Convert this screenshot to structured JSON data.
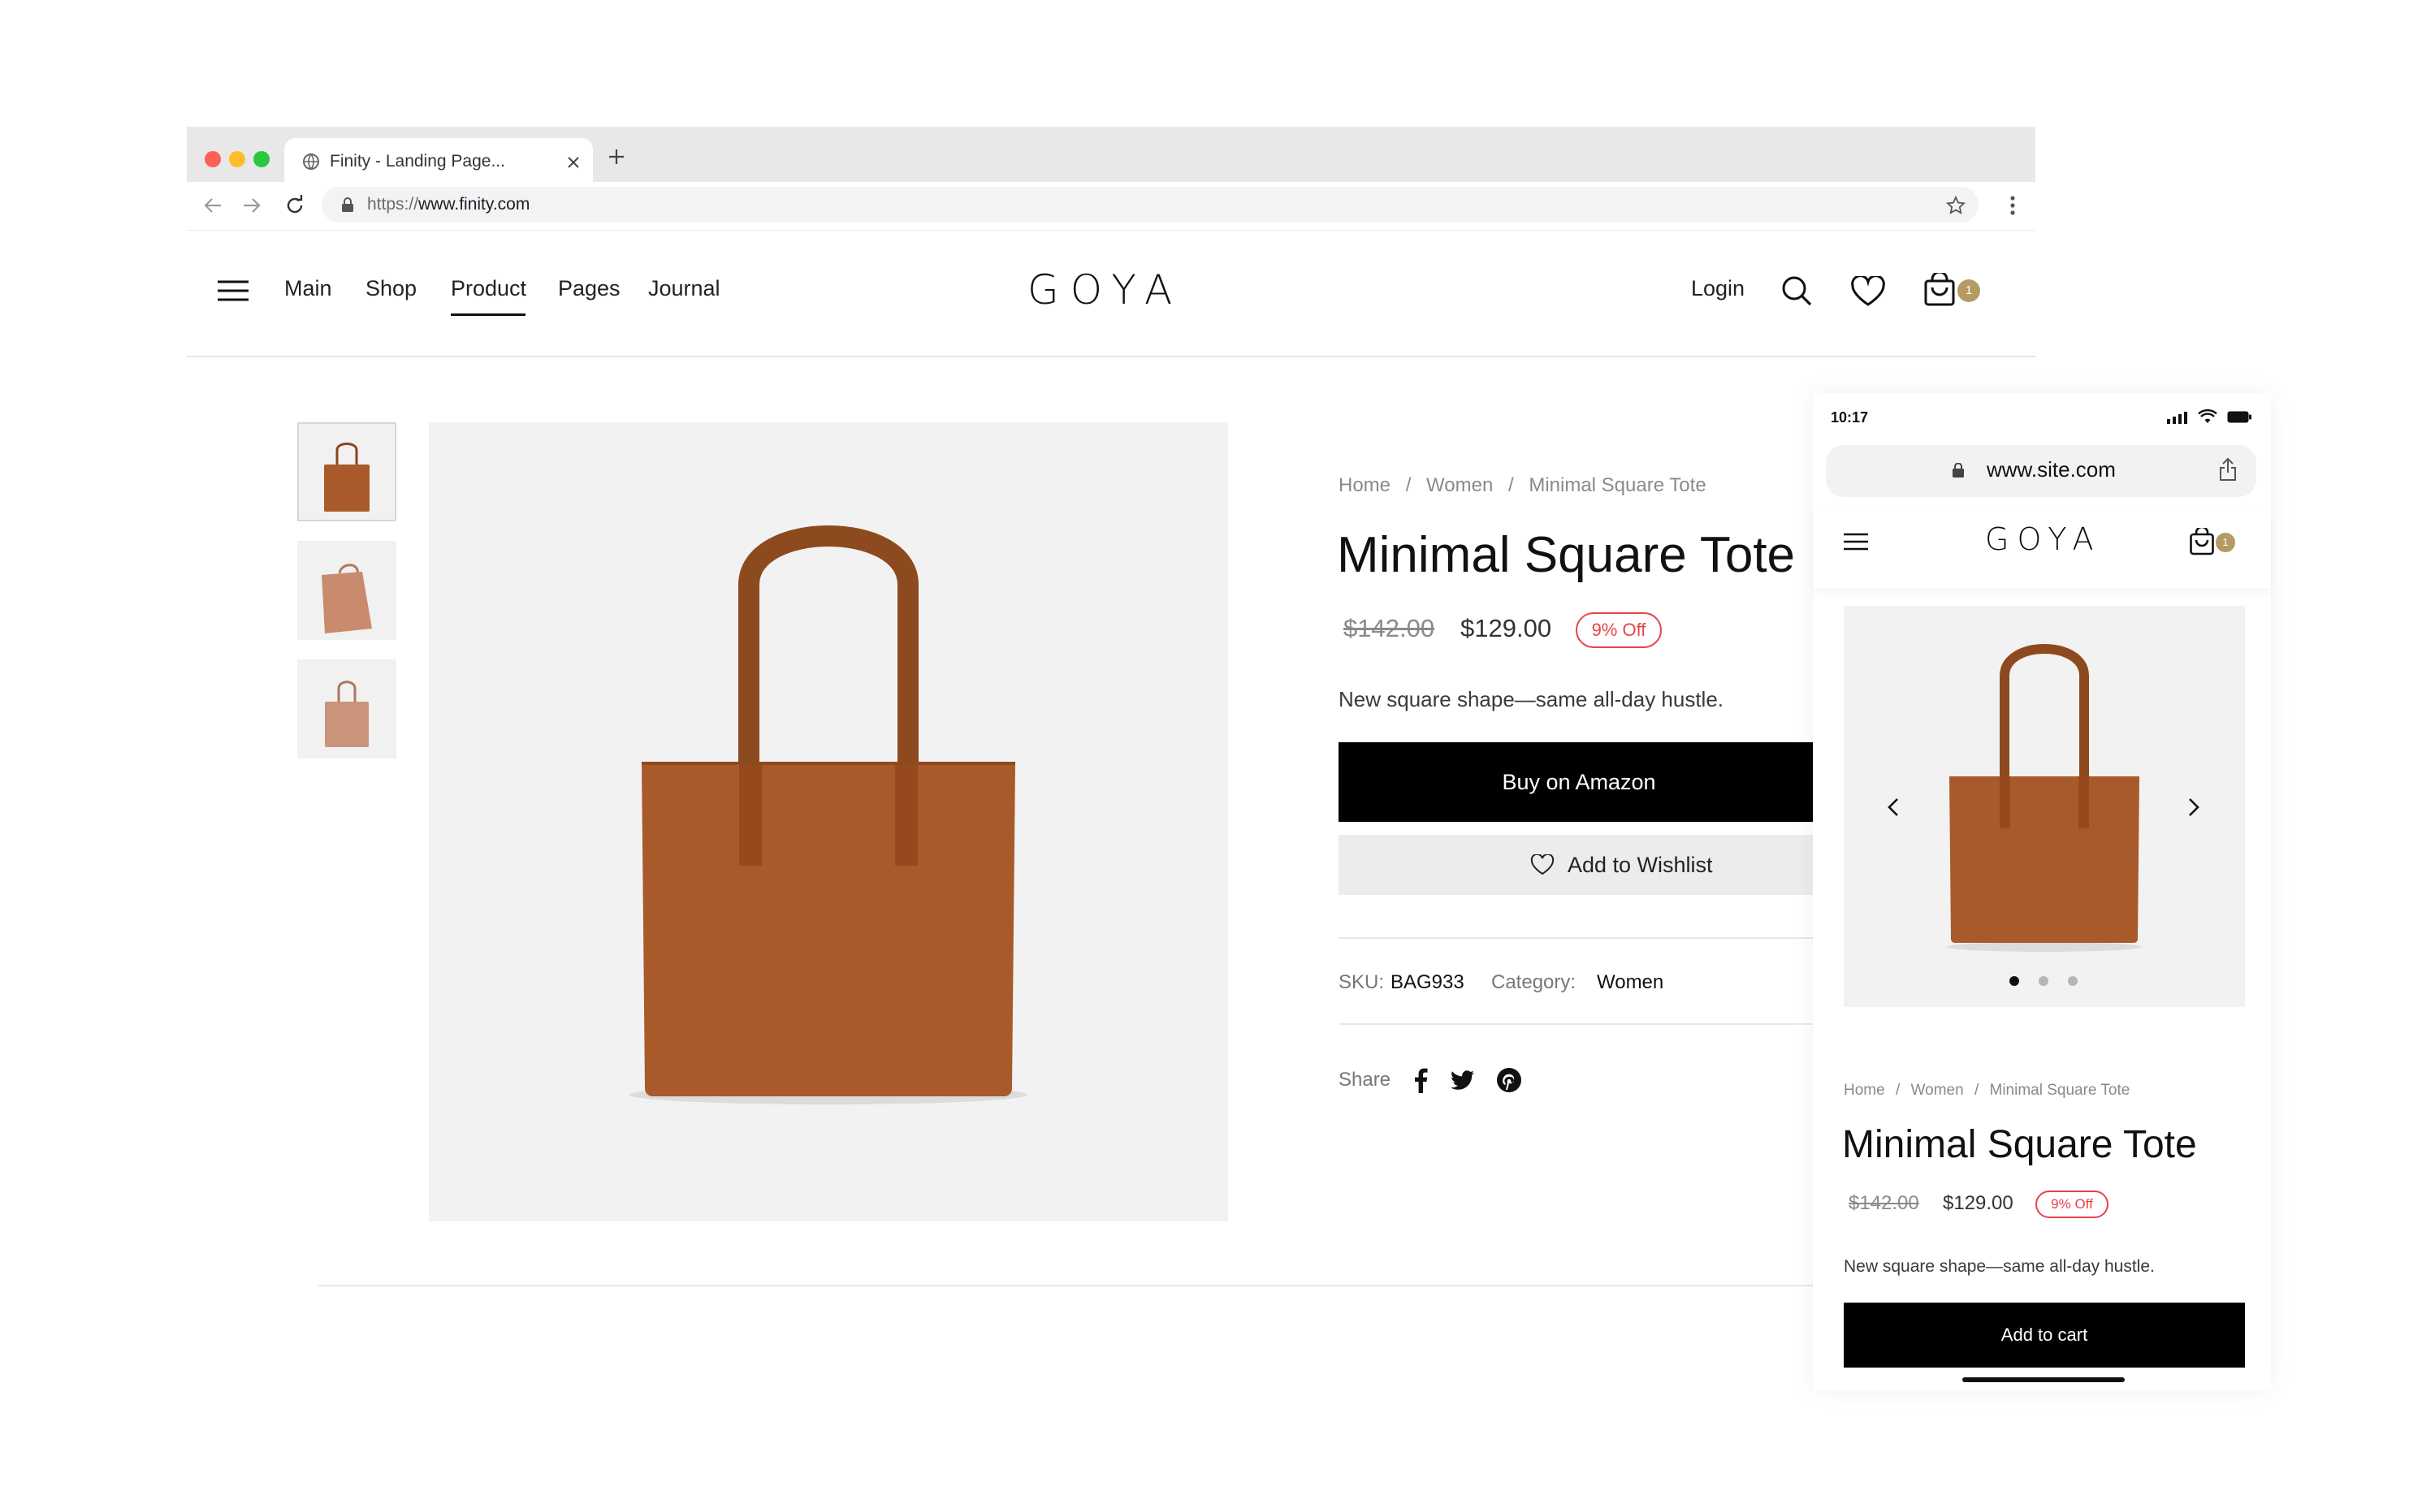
{
  "browser": {
    "tab_title": "Finity - Landing Page...",
    "url_prefix": "https://",
    "url_domain": "www.finity.com",
    "traffic_lights": [
      "#fe5f57",
      "#febc2e",
      "#28c840"
    ]
  },
  "site": {
    "logo": "GOYA",
    "nav": [
      "Main",
      "Shop",
      "Product",
      "Pages",
      "Journal"
    ],
    "active_nav": "Product",
    "login_label": "Login",
    "cart_count": "1"
  },
  "product": {
    "breadcrumb": [
      "Home",
      "Women",
      "Minimal Square Tote"
    ],
    "title": "Minimal Square Tote",
    "old_price": "$142.00",
    "price": "$129.00",
    "discount": "9% Off",
    "description": "New square shape—same all-day hustle.",
    "buy_label": "Buy on Amazon",
    "wishlist_label": "Add to Wishlist",
    "sku_label": "SKU:",
    "sku": "BAG933",
    "category_label": "Category:",
    "category": "Women",
    "share_label": "Share",
    "colors": {
      "leather": "#a85a2a",
      "badge": "#b59a63",
      "discount": "#e8434a"
    }
  },
  "mobile": {
    "time": "10:17",
    "url": "www.site.com",
    "logo": "GOYA",
    "cart_count": "1",
    "breadcrumb": [
      "Home",
      "Women",
      "Minimal Square Tote"
    ],
    "title": "Minimal Square Tote",
    "old_price": "$142.00",
    "price": "$129.00",
    "discount": "9% Off",
    "description": "New square shape—same all-day hustle.",
    "cart_label": "Add to cart",
    "carousel_slides": 3,
    "carousel_active": 1
  }
}
